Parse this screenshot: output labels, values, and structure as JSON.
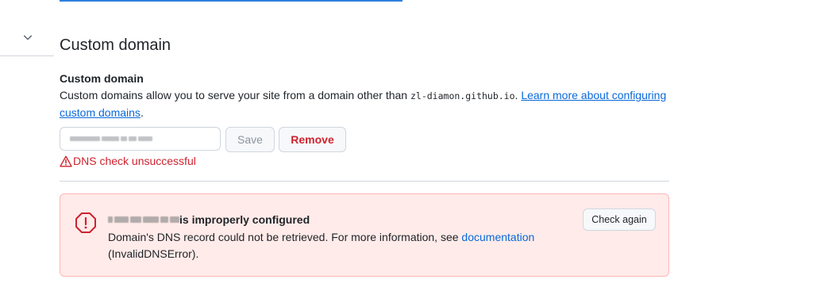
{
  "section": {
    "title": "Custom domain",
    "field_label": "Custom domain",
    "description_prefix": "Custom domains allow you to serve your site from a domain other than ",
    "default_domain": "zl-diamon.github.io",
    "description_suffix": ". ",
    "learn_more_link": "Learn more about configuring custom domains",
    "description_end": "."
  },
  "input": {
    "value": "www.zl-diamon.com"
  },
  "buttons": {
    "save": "Save",
    "remove": "Remove",
    "check_again": "Check again"
  },
  "dns_status": {
    "text": "DNS check unsuccessful"
  },
  "flash": {
    "title_domain": "www.zl-diamon.com",
    "title_suffix": " is improperly configured",
    "body_prefix": "Domain's DNS record could not be retrieved. For more information, see ",
    "body_link": "documentation",
    "body_suffix": "(InvalidDNSError)."
  },
  "colors": {
    "link": "#0969da",
    "danger": "#cf222e",
    "flash_bg": "#ffebe9"
  }
}
